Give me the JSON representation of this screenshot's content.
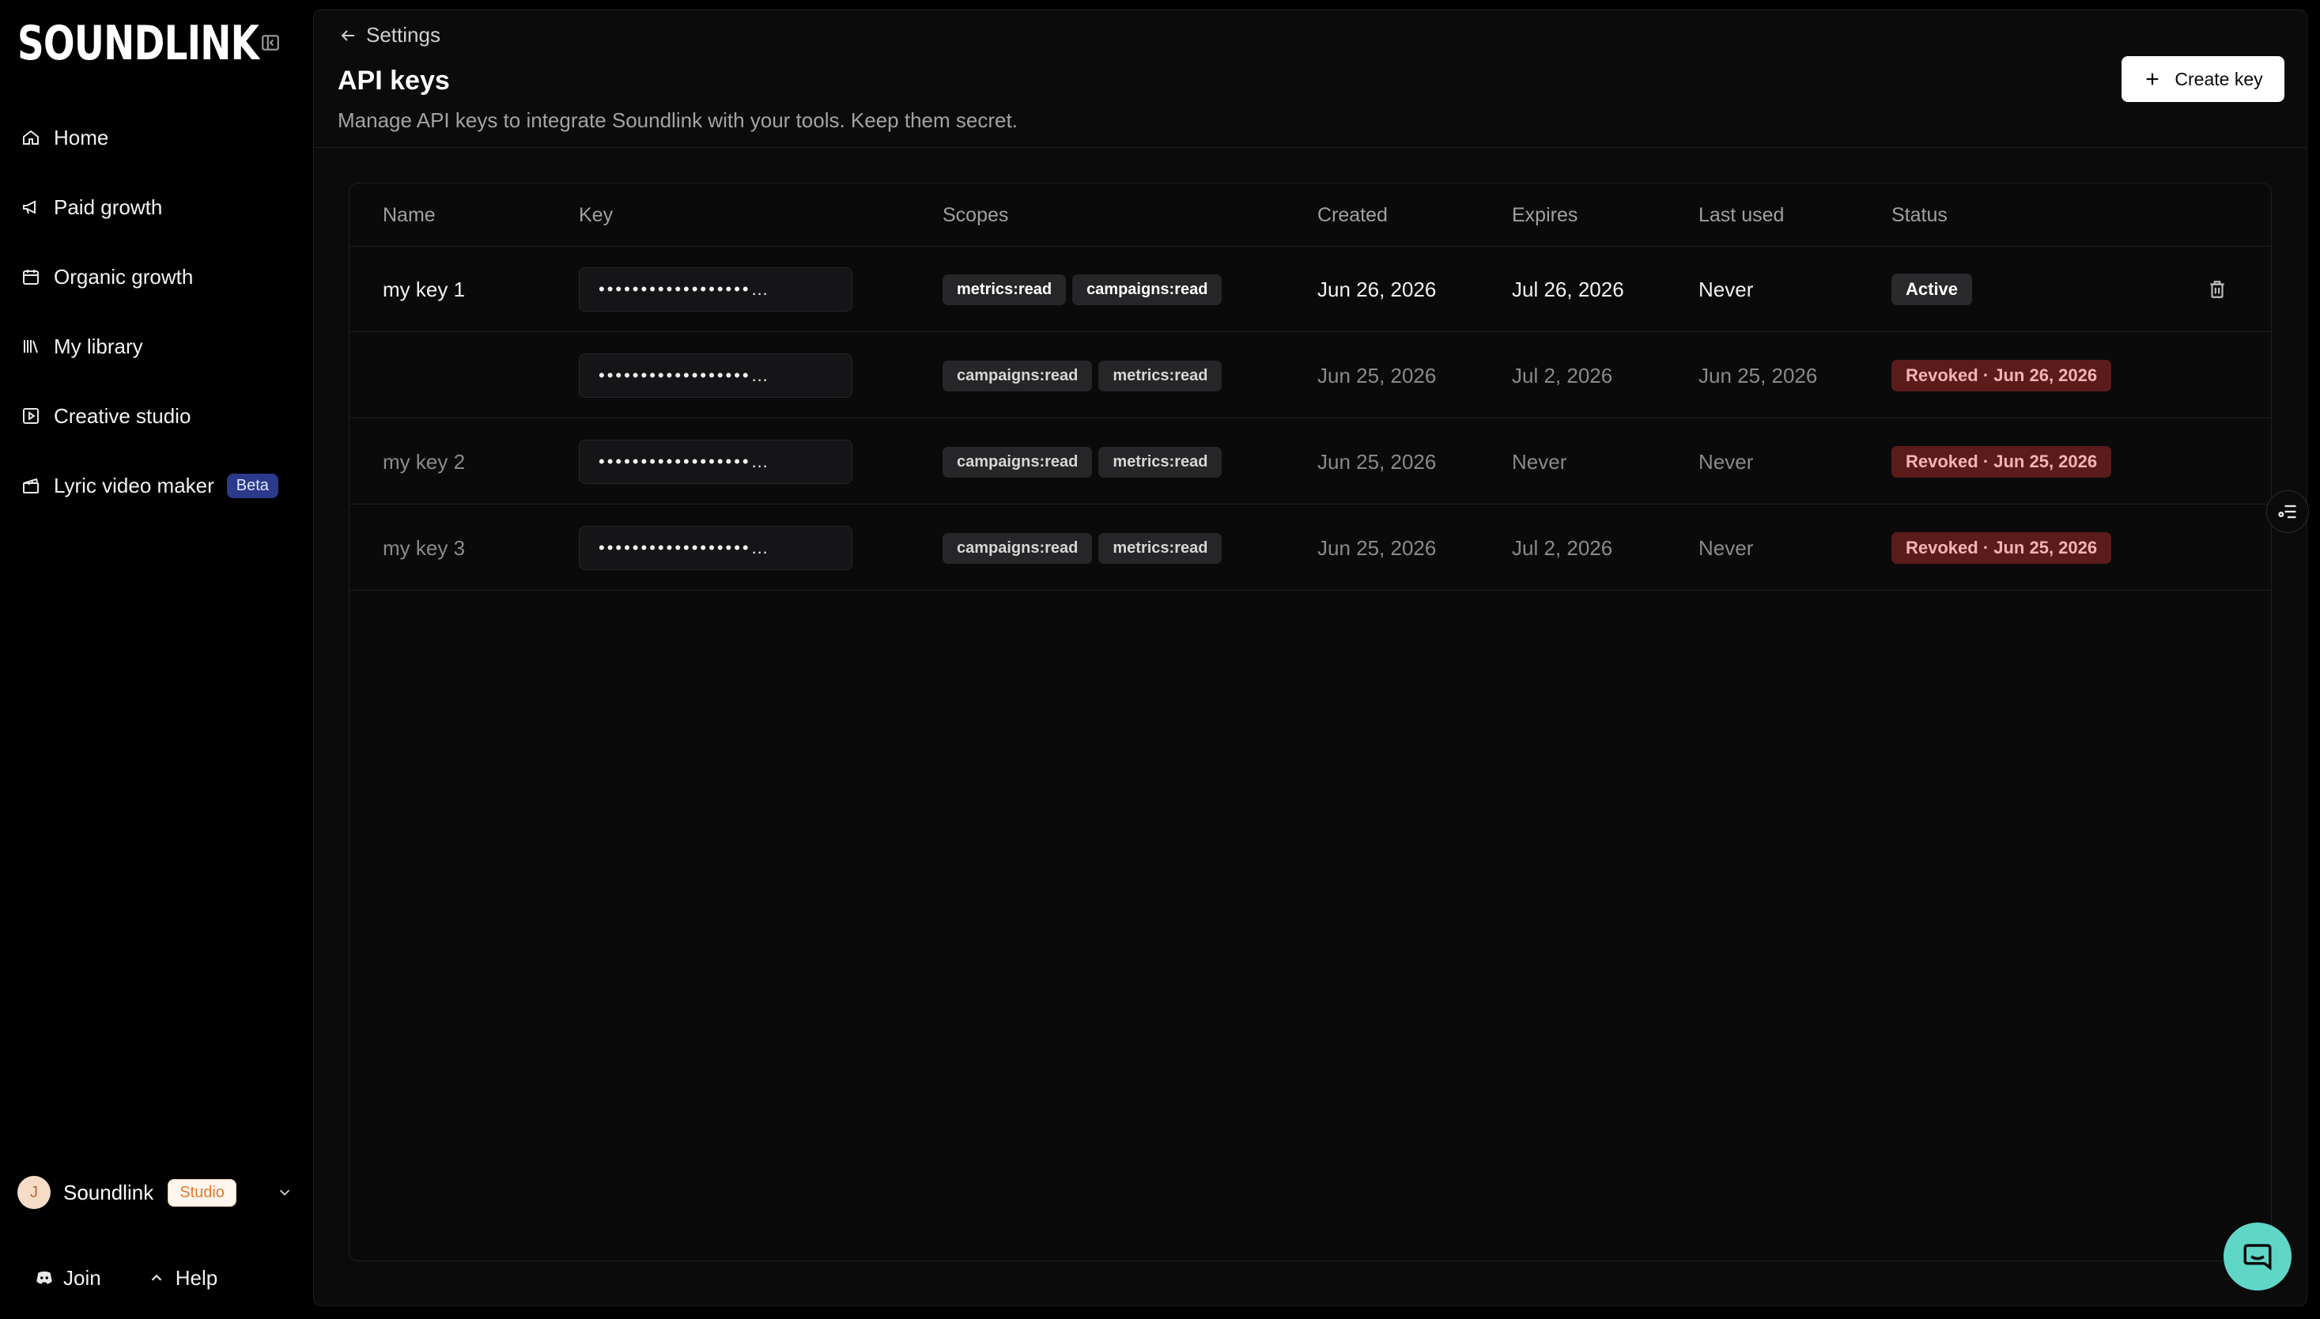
{
  "brand": {
    "logo": "SOUNDLINK"
  },
  "sidebar": {
    "items": [
      {
        "label": "Home",
        "icon": "home-icon"
      },
      {
        "label": "Paid growth",
        "icon": "megaphone-icon"
      },
      {
        "label": "Organic growth",
        "icon": "calendar-icon"
      },
      {
        "label": "My library",
        "icon": "library-icon"
      },
      {
        "label": "Creative studio",
        "icon": "play-square-icon"
      },
      {
        "label": "Lyric video maker",
        "icon": "clapperboard-icon",
        "badge": "Beta"
      }
    ],
    "account": {
      "avatar_initial": "J",
      "name": "Soundlink",
      "plan": "Studio"
    },
    "footer": {
      "join": "Join",
      "help": "Help"
    }
  },
  "header": {
    "back_label": "Settings",
    "title": "API keys",
    "subtitle": "Manage API keys to integrate Soundlink with your tools. Keep them secret.",
    "create_label": "Create key"
  },
  "table": {
    "columns": [
      "Name",
      "Key",
      "Scopes",
      "Created",
      "Expires",
      "Last used",
      "Status"
    ],
    "rows": [
      {
        "name": "my key 1",
        "key": "••••••••••••••••••…",
        "scopes": [
          "metrics:read",
          "campaigns:read"
        ],
        "created": "Jun 26, 2026",
        "expires": "Jul 26, 2026",
        "last_used": "Never",
        "status": "Active"
      },
      {
        "name": "",
        "key": "••••••••••••••••••…",
        "scopes": [
          "campaigns:read",
          "metrics:read"
        ],
        "created": "Jun 25, 2026",
        "expires": "Jul 2, 2026",
        "last_used": "Jun 25, 2026",
        "status": "Revoked · Jun 26, 2026"
      },
      {
        "name": "my key 2",
        "key": "••••••••••••••••••…",
        "scopes": [
          "campaigns:read",
          "metrics:read"
        ],
        "created": "Jun 25, 2026",
        "expires": "Never",
        "last_used": "Never",
        "status": "Revoked · Jun 25, 2026"
      },
      {
        "name": "my key 3",
        "key": "••••••••••••••••••…",
        "scopes": [
          "campaigns:read",
          "metrics:read"
        ],
        "created": "Jun 25, 2026",
        "expires": "Jul 2, 2026",
        "last_used": "Never",
        "status": "Revoked · Jun 25, 2026"
      }
    ]
  },
  "colors": {
    "background": "#000000",
    "panel": "#0b0b0c",
    "revoked_bg": "#5a1b1b",
    "revoked_text": "#f3b3b3",
    "beta_bg": "#2b3a8a",
    "studio_text": "#e07a2c",
    "chat": "#5fd6c6"
  }
}
